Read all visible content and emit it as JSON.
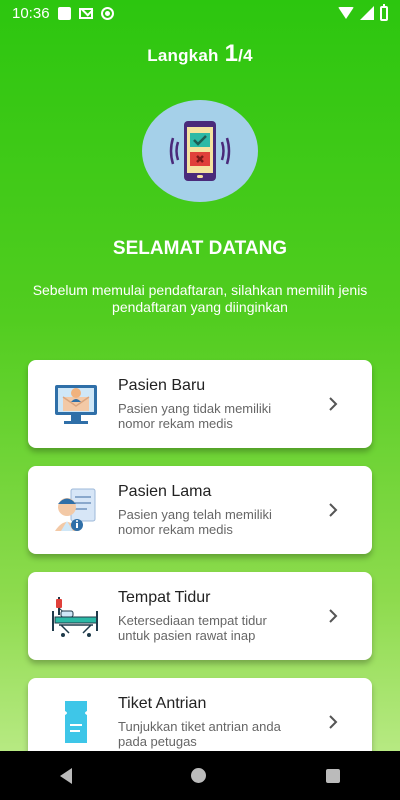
{
  "status": {
    "time": "10:36"
  },
  "step": {
    "label": "Langkah",
    "current": "1",
    "total": "/4"
  },
  "welcome": {
    "title": "SELAMAT DATANG",
    "subtitle": "Sebelum memulai pendaftaran, silahkan memilih jenis pendaftaran yang diinginkan"
  },
  "cards": [
    {
      "title": "Pasien Baru",
      "desc": "Pasien yang tidak memiliki nomor rekam medis",
      "icon": "new-patient-icon"
    },
    {
      "title": "Pasien Lama",
      "desc": "Pasien yang telah memiliki nomor rekam medis",
      "icon": "existing-patient-icon"
    },
    {
      "title": "Tempat Tidur",
      "desc": "Ketersediaan tempat tidur untuk pasien rawat inap",
      "icon": "hospital-bed-icon"
    },
    {
      "title": "Tiket Antrian",
      "desc": "Tunjukkan tiket antrian anda pada petugas",
      "icon": "ticket-icon"
    }
  ],
  "colors": {
    "accent": "#2cc60f",
    "card": "#ffffff"
  }
}
